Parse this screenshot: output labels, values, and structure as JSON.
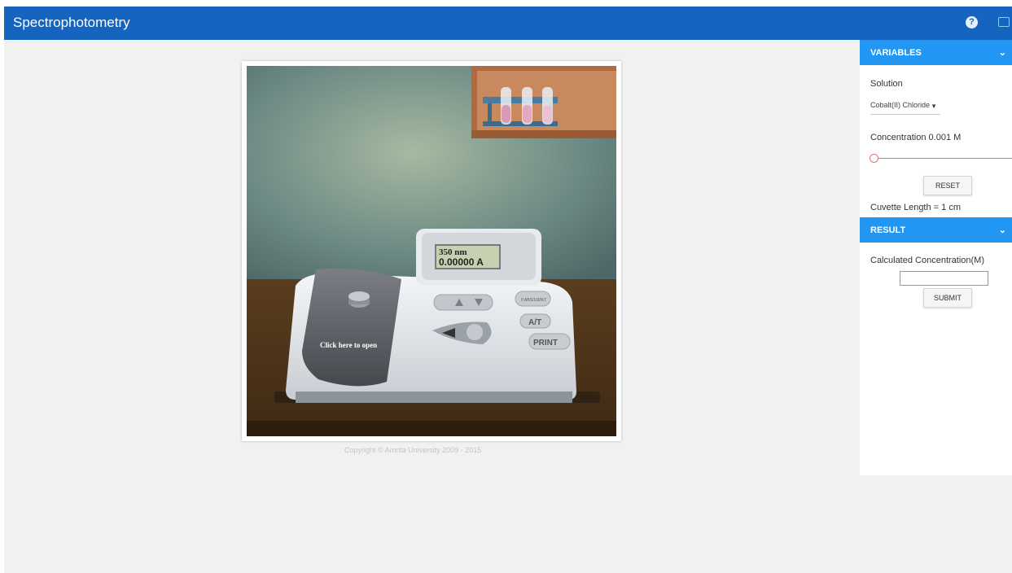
{
  "app": {
    "title": "Spectrophotometry"
  },
  "toolbar": {
    "help_icon": "help-circle-icon",
    "fullscreen_icon": "fullscreen-icon"
  },
  "simulation": {
    "display_wavelength": "350 nm",
    "display_absorbance": "0.00000 A",
    "lid_label": "Click here to open",
    "zero_button_label": "0 ABS/100%T",
    "at_button_label": "A/T",
    "print_button_label": "PRINT",
    "copyright": "Copyright © Amrita University 2009 - 2015"
  },
  "variables": {
    "header": "VARIABLES",
    "solution_label": "Solution",
    "solution_value": "Cobalt(II) Chloride",
    "concentration_label": "Concentration 0.001 M",
    "concentration_fraction": 0.0,
    "reset_label": "RESET",
    "cuvette_label": "Cuvette Length = 1 cm"
  },
  "result": {
    "header": "RESULT",
    "calc_label": "Calculated Concentration(M)",
    "calc_value": "",
    "submit_label": "SUBMIT"
  },
  "colors": {
    "topbar": "#1565c0",
    "section_header": "#2196f3",
    "slider_thumb": "#e57373"
  }
}
